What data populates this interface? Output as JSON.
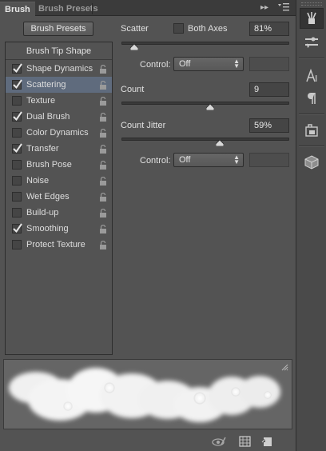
{
  "tabs": [
    {
      "label": "Brush",
      "active": true
    },
    {
      "label": "Brush Presets",
      "active": false
    }
  ],
  "panel_menu_icons": [
    "expand-icon",
    "panel-menu-icon"
  ],
  "brush_presets_button": "Brush Presets",
  "brush_tip_shape": "Brush Tip Shape",
  "options": [
    {
      "label": "Shape Dynamics",
      "checked": true,
      "selected": false
    },
    {
      "label": "Scattering",
      "checked": true,
      "selected": true
    },
    {
      "label": "Texture",
      "checked": false,
      "selected": false
    },
    {
      "label": "Dual Brush",
      "checked": true,
      "selected": false
    },
    {
      "label": "Color Dynamics",
      "checked": false,
      "selected": false
    },
    {
      "label": "Transfer",
      "checked": true,
      "selected": false
    },
    {
      "label": "Brush Pose",
      "checked": false,
      "selected": false
    },
    {
      "label": "Noise",
      "checked": false,
      "selected": false
    },
    {
      "label": "Wet Edges",
      "checked": false,
      "selected": false
    },
    {
      "label": "Build-up",
      "checked": false,
      "selected": false
    },
    {
      "label": "Smoothing",
      "checked": true,
      "selected": false
    },
    {
      "label": "Protect Texture",
      "checked": false,
      "selected": false
    }
  ],
  "settings": {
    "scatter": {
      "label": "Scatter",
      "value": "81%",
      "level_pct": 8
    },
    "both_axes": {
      "label": "Both Axes",
      "checked": false
    },
    "control1": {
      "label": "Control:",
      "value": "Off"
    },
    "count": {
      "label": "Count",
      "value": "9",
      "level_pct": 53
    },
    "count_jitter": {
      "label": "Count Jitter",
      "value": "59%",
      "level_pct": 59
    },
    "control2": {
      "label": "Control:",
      "value": "Off"
    }
  },
  "dock_icons": [
    "brush-tool-icon",
    "brush-settings-icon",
    "character-icon",
    "paragraph-icon",
    "clone-source-icon",
    "3d-icon"
  ],
  "bottom_icons": [
    "toggle-live-tip-icon",
    "grid-icon",
    "new-preset-icon"
  ],
  "colors": {
    "selected_row": "#5f6b7d",
    "panel": "#535353"
  }
}
